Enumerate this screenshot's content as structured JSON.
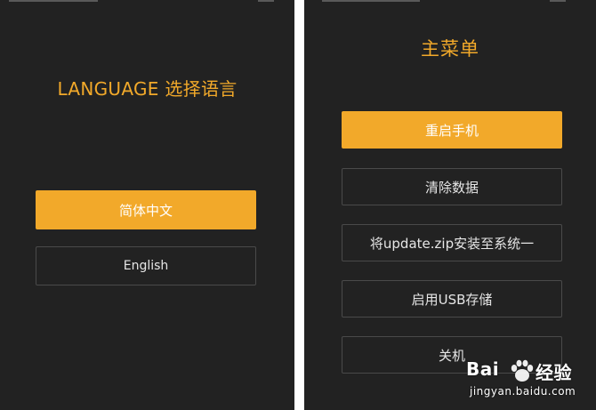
{
  "colors": {
    "accent": "#f2a92a",
    "background": "#222222",
    "button_border": "#4a4a4a",
    "button_text": "#e6e6e6"
  },
  "language_screen": {
    "title": "LANGUAGE 选择语言",
    "options": [
      {
        "label": "简体中文",
        "selected": true
      },
      {
        "label": "English",
        "selected": false
      }
    ]
  },
  "menu_screen": {
    "title": "主菜单",
    "items": [
      {
        "label": "重启手机",
        "highlighted": true
      },
      {
        "label": "清除数据",
        "highlighted": false
      },
      {
        "label": "将update.zip安装至系统一",
        "highlighted": false
      },
      {
        "label": "启用USB存储",
        "highlighted": false
      },
      {
        "label": "关机",
        "highlighted": false
      }
    ]
  },
  "watermark": {
    "brand": "Bai",
    "logo_icon": "baidu-paw-icon",
    "service": "经验",
    "url": "jingyan.baidu.com"
  }
}
